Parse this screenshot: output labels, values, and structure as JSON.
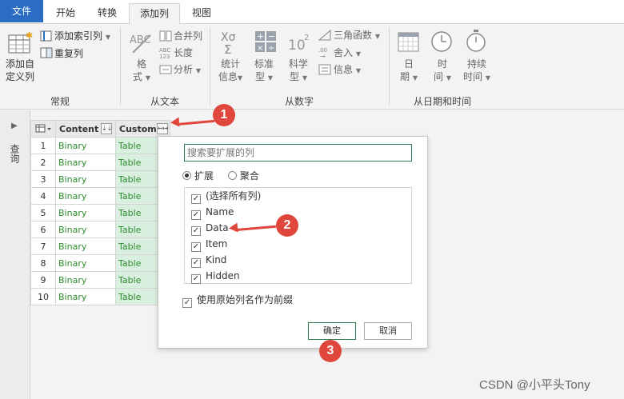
{
  "tabs": [
    "文件",
    "开始",
    "转换",
    "添加列",
    "视图"
  ],
  "ribbon": {
    "custom_col_l1": "添加自",
    "custom_col_l2": "定义列",
    "index_col": "添加索引列",
    "dup_col": "重复列",
    "group_general": "常规",
    "format_l1": "格",
    "format_l2": "式",
    "merge_col": "合并列",
    "length": "长度",
    "parse": "分析",
    "group_text": "从文本",
    "stats_l1": "统计",
    "stats_l2": "信息",
    "standard_l1": "标准",
    "standard_l2": "型",
    "sci_l1": "科学",
    "sci_l2": "型",
    "trig": "三角函数",
    "round": "舍入",
    "info": "信息",
    "group_number": "从数字",
    "date_l1": "日",
    "date_l2": "期",
    "time_l1": "时",
    "time_l2": "间",
    "dur_l1": "持续",
    "dur_l2": "时间",
    "group_datetime": "从日期和时间"
  },
  "query_pane": {
    "label": "查询"
  },
  "grid": {
    "col_content": "Content",
    "col_custom": "Custom",
    "rows": [
      {
        "i": "1",
        "content": "Binary",
        "custom": "Table"
      },
      {
        "i": "2",
        "content": "Binary",
        "custom": "Table"
      },
      {
        "i": "3",
        "content": "Binary",
        "custom": "Table"
      },
      {
        "i": "4",
        "content": "Binary",
        "custom": "Table"
      },
      {
        "i": "5",
        "content": "Binary",
        "custom": "Table"
      },
      {
        "i": "6",
        "content": "Binary",
        "custom": "Table"
      },
      {
        "i": "7",
        "content": "Binary",
        "custom": "Table"
      },
      {
        "i": "8",
        "content": "Binary",
        "custom": "Table"
      },
      {
        "i": "9",
        "content": "Binary",
        "custom": "Table"
      },
      {
        "i": "10",
        "content": "Binary",
        "custom": "Table"
      }
    ]
  },
  "popup": {
    "search_placeholder": "搜索要扩展的列",
    "radio_expand": "扩展",
    "radio_aggregate": "聚合",
    "items": [
      "(选择所有列)",
      "Name",
      "Data",
      "Item",
      "Kind",
      "Hidden"
    ],
    "prefix_label": "使用原始列名作为前缀",
    "ok": "确定",
    "cancel": "取消"
  },
  "annotations": [
    "1",
    "2",
    "3"
  ],
  "watermark": "CSDN @小平头Tony",
  "colors": {
    "file_tab": "#2b6cc4",
    "badge": "#e0473c",
    "table_text": "#2e8b2e",
    "custom_bg": "#d9efe0"
  }
}
